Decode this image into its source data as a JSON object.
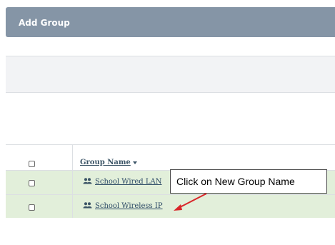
{
  "header": {
    "title": "Add Group",
    "bar_color": "#8595a6"
  },
  "table": {
    "columns": [
      {
        "label": "",
        "type": "checkbox"
      },
      {
        "label": "Group Name",
        "sort_icon": "sort-down-icon"
      }
    ],
    "rows": [
      {
        "name": "School Wired LAN",
        "icon": "group-icon"
      },
      {
        "name": "School Wireless IP",
        "icon": "group-icon"
      }
    ],
    "row_color": "#e2efda"
  },
  "annotation": {
    "callout_text": "Click on New Group Name",
    "arrow_color": "#d9262a"
  }
}
